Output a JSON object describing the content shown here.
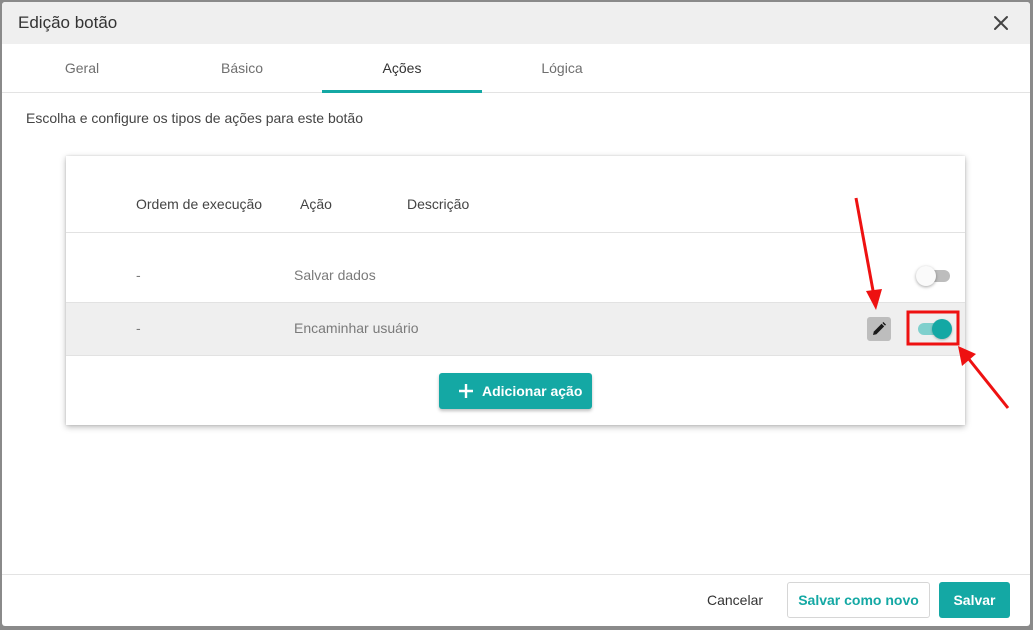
{
  "dialog": {
    "title": "Edição botão",
    "close_icon": "close-icon"
  },
  "tabs": [
    {
      "label": "Geral",
      "active": false
    },
    {
      "label": "Básico",
      "active": false
    },
    {
      "label": "Ações",
      "active": true
    },
    {
      "label": "Lógica",
      "active": false
    }
  ],
  "intro_text": "Escolha e configure os tipos de ações para este botão",
  "table": {
    "headers": {
      "order": "Ordem de execução",
      "action": "Ação",
      "description": "Descrição"
    },
    "rows": [
      {
        "order": "-",
        "action": "Salvar dados",
        "enabled": false,
        "highlighted": false
      },
      {
        "order": "-",
        "action": "Encaminhar usuário",
        "enabled": true,
        "highlighted": true
      }
    ],
    "add_button_label": "Adicionar ação"
  },
  "footer": {
    "cancel_label": "Cancelar",
    "save_as_new_label": "Salvar como novo",
    "save_label": "Salvar"
  },
  "colors": {
    "accent": "#14a8a4",
    "annotation": "#ee1111"
  }
}
